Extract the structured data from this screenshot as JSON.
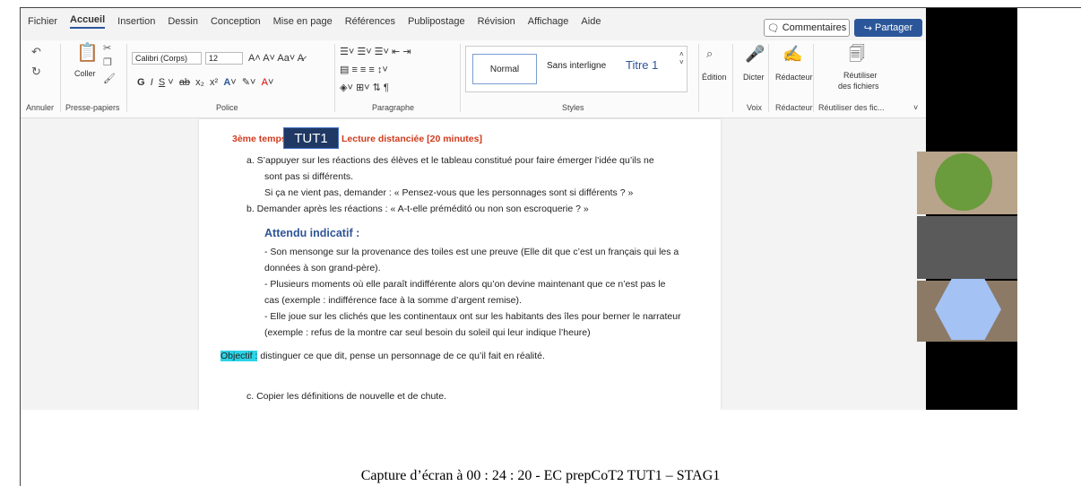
{
  "menu": {
    "tabs": [
      "Fichier",
      "Accueil",
      "Insertion",
      "Dessin",
      "Conception",
      "Mise en page",
      "Références",
      "Publipostage",
      "Révision",
      "Affichage",
      "Aide"
    ],
    "active": "Accueil",
    "comments_label": "Commentaires",
    "share_label": "Partager"
  },
  "ribbon": {
    "paste_label": "Coller",
    "font_name": "Calibri (Corps)",
    "font_size": "12",
    "styles": {
      "normal": "Normal",
      "nospacing": "Sans interligne",
      "title1": "Titre 1"
    },
    "edit_label": "Édition",
    "dictate_label": "Dicter",
    "editor_label": "Rédacteur",
    "reuse_label_1": "Réutiliser",
    "reuse_label_2": "des fichiers",
    "groups": {
      "undo": "Annuler",
      "clipboard": "Presse-papiers",
      "font": "Police",
      "paragraph": "Paragraphe",
      "styles": "Styles",
      "voice": "Voix",
      "editor": "Rédacteur",
      "reuse": "Réutiliser des fic..."
    }
  },
  "document": {
    "heading_prefix": "3ème temps",
    "badge": "TUT1",
    "heading_rest": "Lecture distanciée [20 minutes]",
    "item_a_1": "a.   S’appuyer sur les réactions des élèves et le tableau constitué pour faire émerger l’idée qu’ils ne",
    "item_a_2": "sont pas si différents.",
    "item_a_3": "Si ça ne vient pas, demander : « Pensez-vous que les personnages sont si différents ? »",
    "item_b": "b.   Demander après les réactions : « A-t-elle préméditó ou non son escroquerie ? »",
    "attendu_title": "Attendu indicatif :",
    "attendu_lines": [
      "- Son mensonge sur la provenance des toiles est une preuve (Elle dit que c’est un français qui les a",
      "données à son grand-père).",
      "- Plusieurs moments où elle paraît indifférente alors qu’on devine maintenant que ce n’est pas le",
      "cas (exemple : indifférence face à la somme d’argent remise).",
      "- Elle joue sur les clichés que les continentaux ont sur les habitants des îles pour berner le narrateur",
      "(exemple : refus de la montre car seul besoin du soleil qui leur indique l’heure)"
    ],
    "objective_label": "Objectif :",
    "objective_text": " distinguer ce que dit, pense un personnage de ce qu’il fait en réalité.",
    "item_c": "c.   Copier les définitions de nouvelle et de chute."
  },
  "caption": "Capture d’écran à 00 : 24 : 20 - EC prepCoT2 TUT1 – STAG1",
  "colors": {
    "accent": "#2b579a",
    "red": "#d13a1c",
    "blue": "#2f5597",
    "highlight": "#2cd3e6",
    "green": "#6a9b3c",
    "hex": "#a4c2f4"
  }
}
